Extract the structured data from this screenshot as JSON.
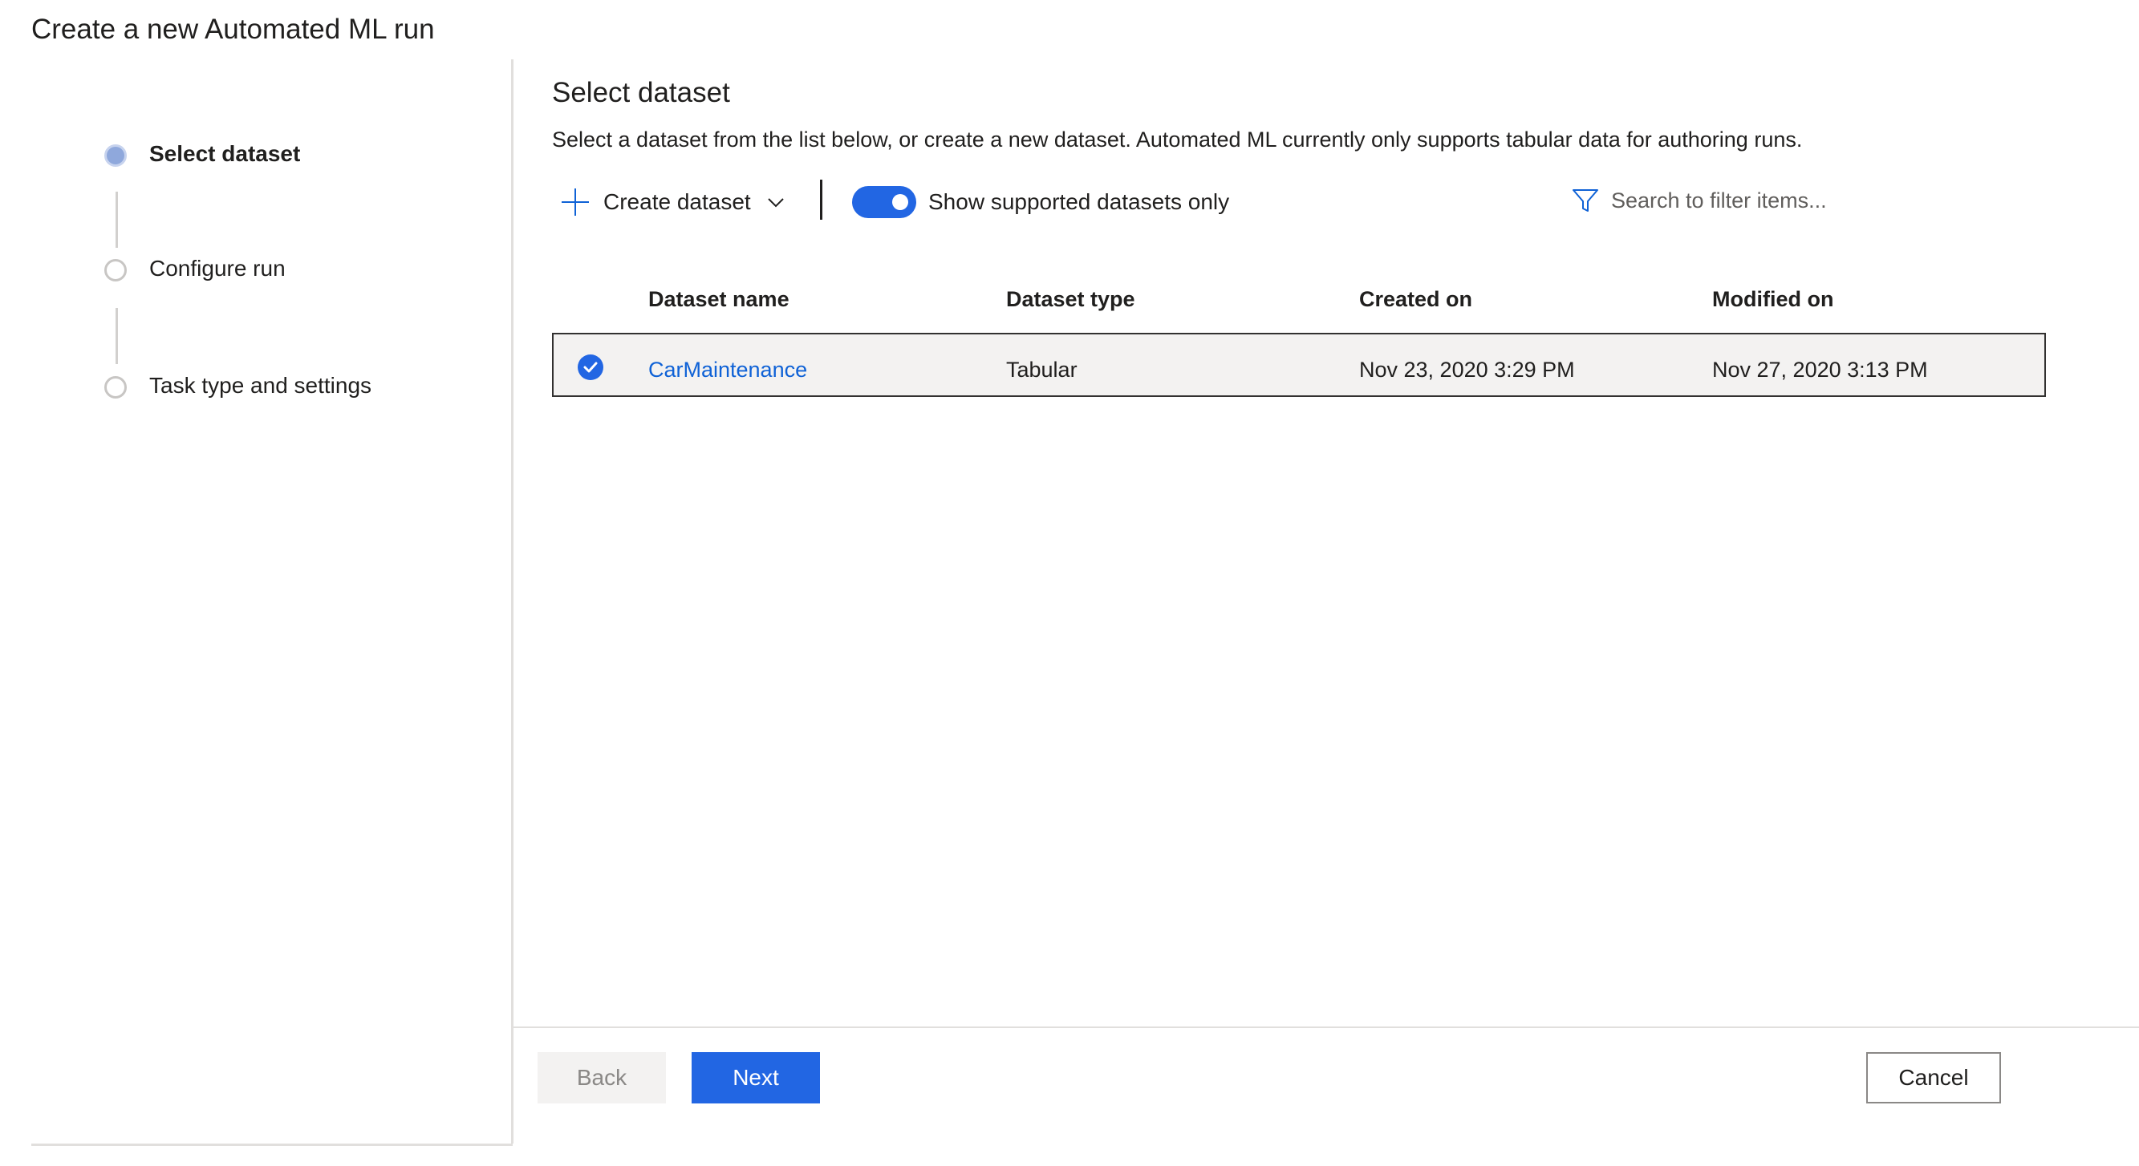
{
  "page": {
    "title": "Create a new Automated ML run"
  },
  "wizard": {
    "steps": [
      {
        "label": "Select dataset",
        "state": "active"
      },
      {
        "label": "Configure run",
        "state": "pending"
      },
      {
        "label": "Task type and settings",
        "state": "pending"
      }
    ]
  },
  "main": {
    "title": "Select dataset",
    "description": "Select a dataset from the list below, or create a new dataset. Automated ML currently only supports tabular data for authoring runs."
  },
  "toolbar": {
    "create_label": "Create dataset",
    "create_icon": "plus-icon",
    "dropdown_icon": "chevron-down-icon",
    "toggle_label": "Show supported datasets only",
    "toggle_on": true,
    "search_placeholder": "Search to filter items...",
    "search_icon": "filter-icon"
  },
  "table": {
    "columns": [
      "Dataset name",
      "Dataset type",
      "Created on",
      "Modified on"
    ],
    "rows": [
      {
        "selected": true,
        "name": "CarMaintenance",
        "type": "Tabular",
        "created": "Nov 23, 2020 3:29 PM",
        "modified": "Nov 27, 2020 3:13 PM"
      }
    ]
  },
  "footer": {
    "back_label": "Back",
    "next_label": "Next",
    "cancel_label": "Cancel"
  },
  "colors": {
    "accent": "#2266e3",
    "link": "#0f62d6",
    "divider": "#e1dfdd",
    "selected_row": "#f3f2f1"
  }
}
